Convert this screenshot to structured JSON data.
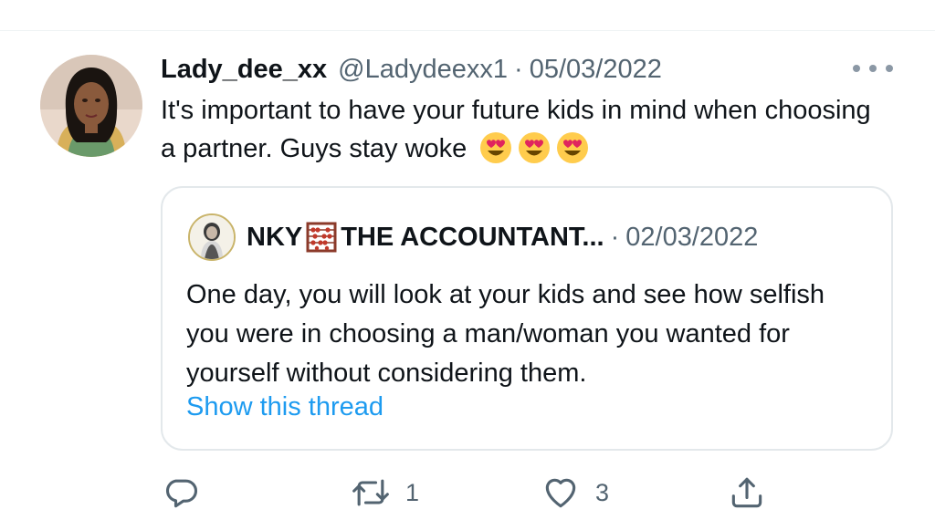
{
  "tweet": {
    "author_name": "Lady_dee_xx",
    "handle": "@Ladydeexx1",
    "separator": "·",
    "date": "05/03/2022",
    "text": "It's important to have your future kids in mind when choosing a partner. Guys stay woke",
    "emojis": [
      "heart-eyes-emoji",
      "heart-eyes-emoji",
      "heart-eyes-emoji"
    ]
  },
  "quote": {
    "author_name_part1": "NKY",
    "author_name_part2": "THE ACCOUNTANT...",
    "separator": "·",
    "date": "02/03/2022",
    "text": "One day, you will look at your kids and see how selfish you were in choosing a man/woman you wanted for yourself without considering them.",
    "show_thread": "Show this thread"
  },
  "actions": {
    "reply_icon": "reply-icon",
    "retweet_icon": "retweet-icon",
    "retweet_count": "1",
    "like_icon": "heart-icon",
    "like_count": "3",
    "share_icon": "share-icon"
  },
  "colors": {
    "link": "#1d9bf0",
    "secondary_text": "#536471",
    "icon": "#536471",
    "border": "#e3e8eb"
  }
}
